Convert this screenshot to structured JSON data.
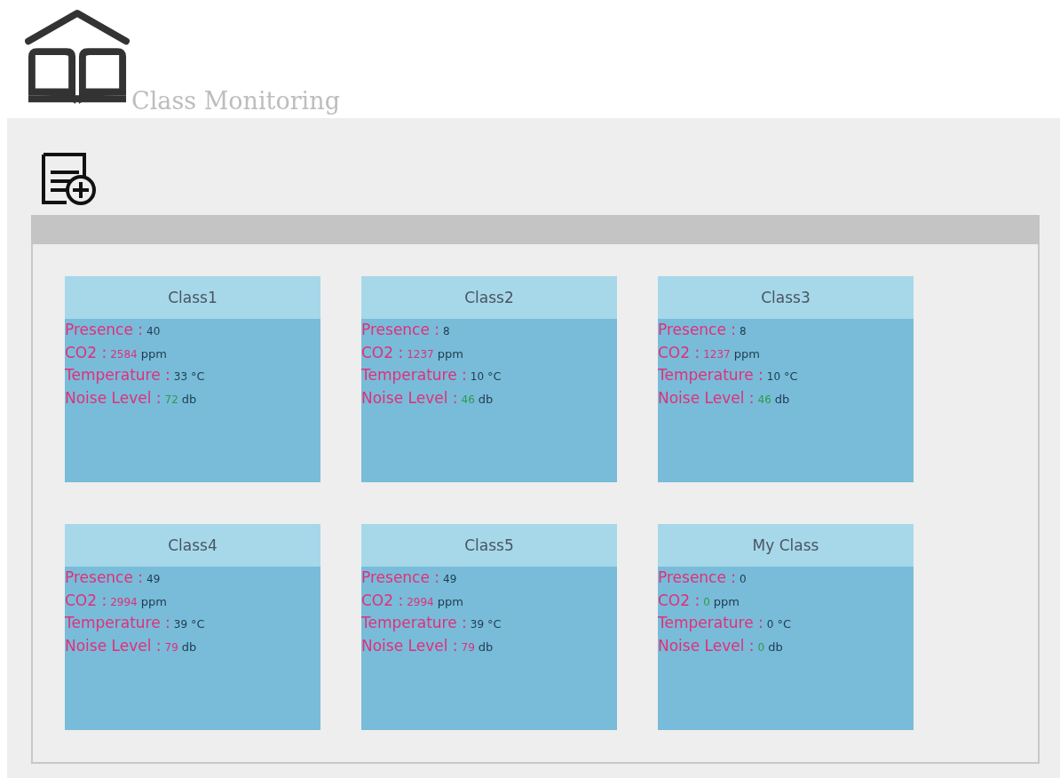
{
  "header": {
    "title": "Class Monitoring"
  },
  "classes": [
    {
      "name": "Class1",
      "metrics": [
        {
          "label": "Presence :",
          "value": "40",
          "color": "#1f3b4d"
        },
        {
          "label": "CO2 :",
          "value": "2584",
          "unit": "ppm",
          "color": "#e0307a"
        },
        {
          "label": "Temperature :",
          "value": "33",
          "unit": "°C",
          "color": "#1f3b4d"
        },
        {
          "label": "Noise Level :",
          "value": "72",
          "unit": "db",
          "color": "#2e9a4a"
        }
      ]
    },
    {
      "name": "Class2",
      "metrics": [
        {
          "label": "Presence :",
          "value": "8",
          "color": "#1f3b4d"
        },
        {
          "label": "CO2 :",
          "value": "1237",
          "unit": "ppm",
          "color": "#e0307a"
        },
        {
          "label": "Temperature :",
          "value": "10",
          "unit": "°C",
          "color": "#1f3b4d"
        },
        {
          "label": "Noise Level :",
          "value": "46",
          "unit": "db",
          "color": "#2e9a4a"
        }
      ]
    },
    {
      "name": "Class3",
      "metrics": [
        {
          "label": "Presence :",
          "value": "8",
          "color": "#1f3b4d"
        },
        {
          "label": "CO2 :",
          "value": "1237",
          "unit": "ppm",
          "color": "#e0307a"
        },
        {
          "label": "Temperature :",
          "value": "10",
          "unit": "°C",
          "color": "#1f3b4d"
        },
        {
          "label": "Noise Level :",
          "value": "46",
          "unit": "db",
          "color": "#2e9a4a"
        }
      ]
    },
    {
      "name": "Class4",
      "metrics": [
        {
          "label": "Presence :",
          "value": "49",
          "color": "#1f3b4d"
        },
        {
          "label": "CO2 :",
          "value": "2994",
          "unit": "ppm",
          "color": "#e0307a"
        },
        {
          "label": "Temperature :",
          "value": "39",
          "unit": "°C",
          "color": "#1f3b4d"
        },
        {
          "label": "Noise Level :",
          "value": "79",
          "unit": "db",
          "color": "#e0307a"
        }
      ]
    },
    {
      "name": "Class5",
      "metrics": [
        {
          "label": "Presence :",
          "value": "49",
          "color": "#1f3b4d"
        },
        {
          "label": "CO2 :",
          "value": "2994",
          "unit": "ppm",
          "color": "#e0307a"
        },
        {
          "label": "Temperature :",
          "value": "39",
          "unit": "°C",
          "color": "#1f3b4d"
        },
        {
          "label": "Noise Level :",
          "value": "79",
          "unit": "db",
          "color": "#e0307a"
        }
      ]
    },
    {
      "name": "My Class",
      "metrics": [
        {
          "label": "Presence :",
          "value": "0",
          "color": "#1f3b4d"
        },
        {
          "label": "CO2 :",
          "value": "0",
          "unit": "ppm",
          "color": "#2e9a4a"
        },
        {
          "label": "Temperature :",
          "value": "0",
          "unit": "°C",
          "color": "#1f3b4d"
        },
        {
          "label": "Noise Level :",
          "value": "0",
          "unit": "db",
          "color": "#2e9a4a"
        }
      ]
    }
  ]
}
